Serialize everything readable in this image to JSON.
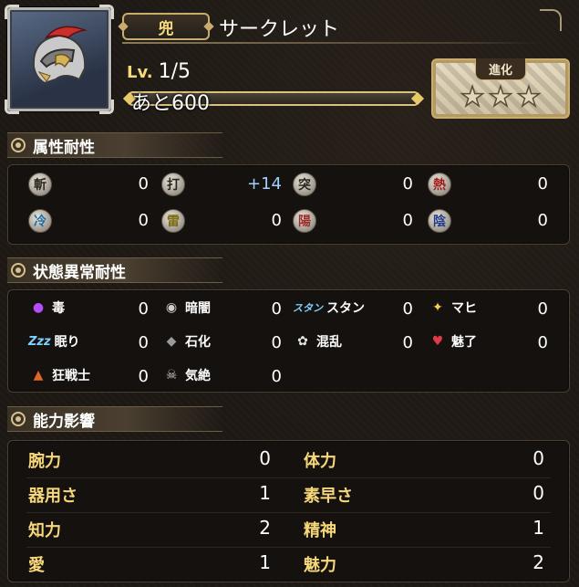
{
  "header": {
    "type_badge": "兜",
    "item_name": "サークレット",
    "level_label": "Lv.",
    "level_value": "1/5",
    "exp_remaining": "あと600",
    "exp_progress": 0.0,
    "evolve_label": "進化",
    "evolve_stars_filled": 0,
    "evolve_stars_total": 3,
    "item_icon": "helmet-icon"
  },
  "sections": {
    "attribute": "属性耐性",
    "status": "状態異常耐性",
    "ability": "能力影響"
  },
  "attribute_resist": [
    {
      "icon": "slash-icon",
      "glyph": "斬",
      "value": "0"
    },
    {
      "icon": "blunt-icon",
      "glyph": "打",
      "value": "+14"
    },
    {
      "icon": "pierce-icon",
      "glyph": "突",
      "value": "0"
    },
    {
      "icon": "fire-icon",
      "glyph": "熱",
      "value": "0"
    },
    {
      "icon": "ice-icon",
      "glyph": "冷",
      "value": "0"
    },
    {
      "icon": "thunder-icon",
      "glyph": "雷",
      "value": "0"
    },
    {
      "icon": "light-icon",
      "glyph": "陽",
      "value": "0"
    },
    {
      "icon": "dark-icon",
      "glyph": "陰",
      "value": "0"
    }
  ],
  "status_resist": [
    {
      "icon": "poison-icon",
      "label": "毒",
      "value": "0"
    },
    {
      "icon": "blind-icon",
      "label": "暗闇",
      "value": "0"
    },
    {
      "icon": "stun-icon",
      "label": "スタン",
      "value": "0",
      "icon_text": "スタン"
    },
    {
      "icon": "paralysis-icon",
      "label": "マヒ",
      "value": "0"
    },
    {
      "icon": "sleep-icon",
      "label": "眠り",
      "value": "0",
      "icon_text": "Zzz"
    },
    {
      "icon": "petrify-icon",
      "label": "石化",
      "value": "0"
    },
    {
      "icon": "confusion-icon",
      "label": "混乱",
      "value": "0"
    },
    {
      "icon": "charm-icon",
      "label": "魅了",
      "value": "0"
    },
    {
      "icon": "berserk-icon",
      "label": "狂戦士",
      "value": "0"
    },
    {
      "icon": "faint-icon",
      "label": "気絶",
      "value": "0"
    }
  ],
  "abilities": [
    {
      "label": "腕力",
      "value": "0"
    },
    {
      "label": "体力",
      "value": "0"
    },
    {
      "label": "器用さ",
      "value": "1"
    },
    {
      "label": "素早さ",
      "value": "0"
    },
    {
      "label": "知力",
      "value": "2"
    },
    {
      "label": "精神",
      "value": "1"
    },
    {
      "label": "愛",
      "value": "1"
    },
    {
      "label": "魅力",
      "value": "2"
    }
  ],
  "colors": {
    "gold": "#f6d779",
    "plus_value": "#9fd0ff",
    "exp_fill": "#2e8fd4"
  }
}
